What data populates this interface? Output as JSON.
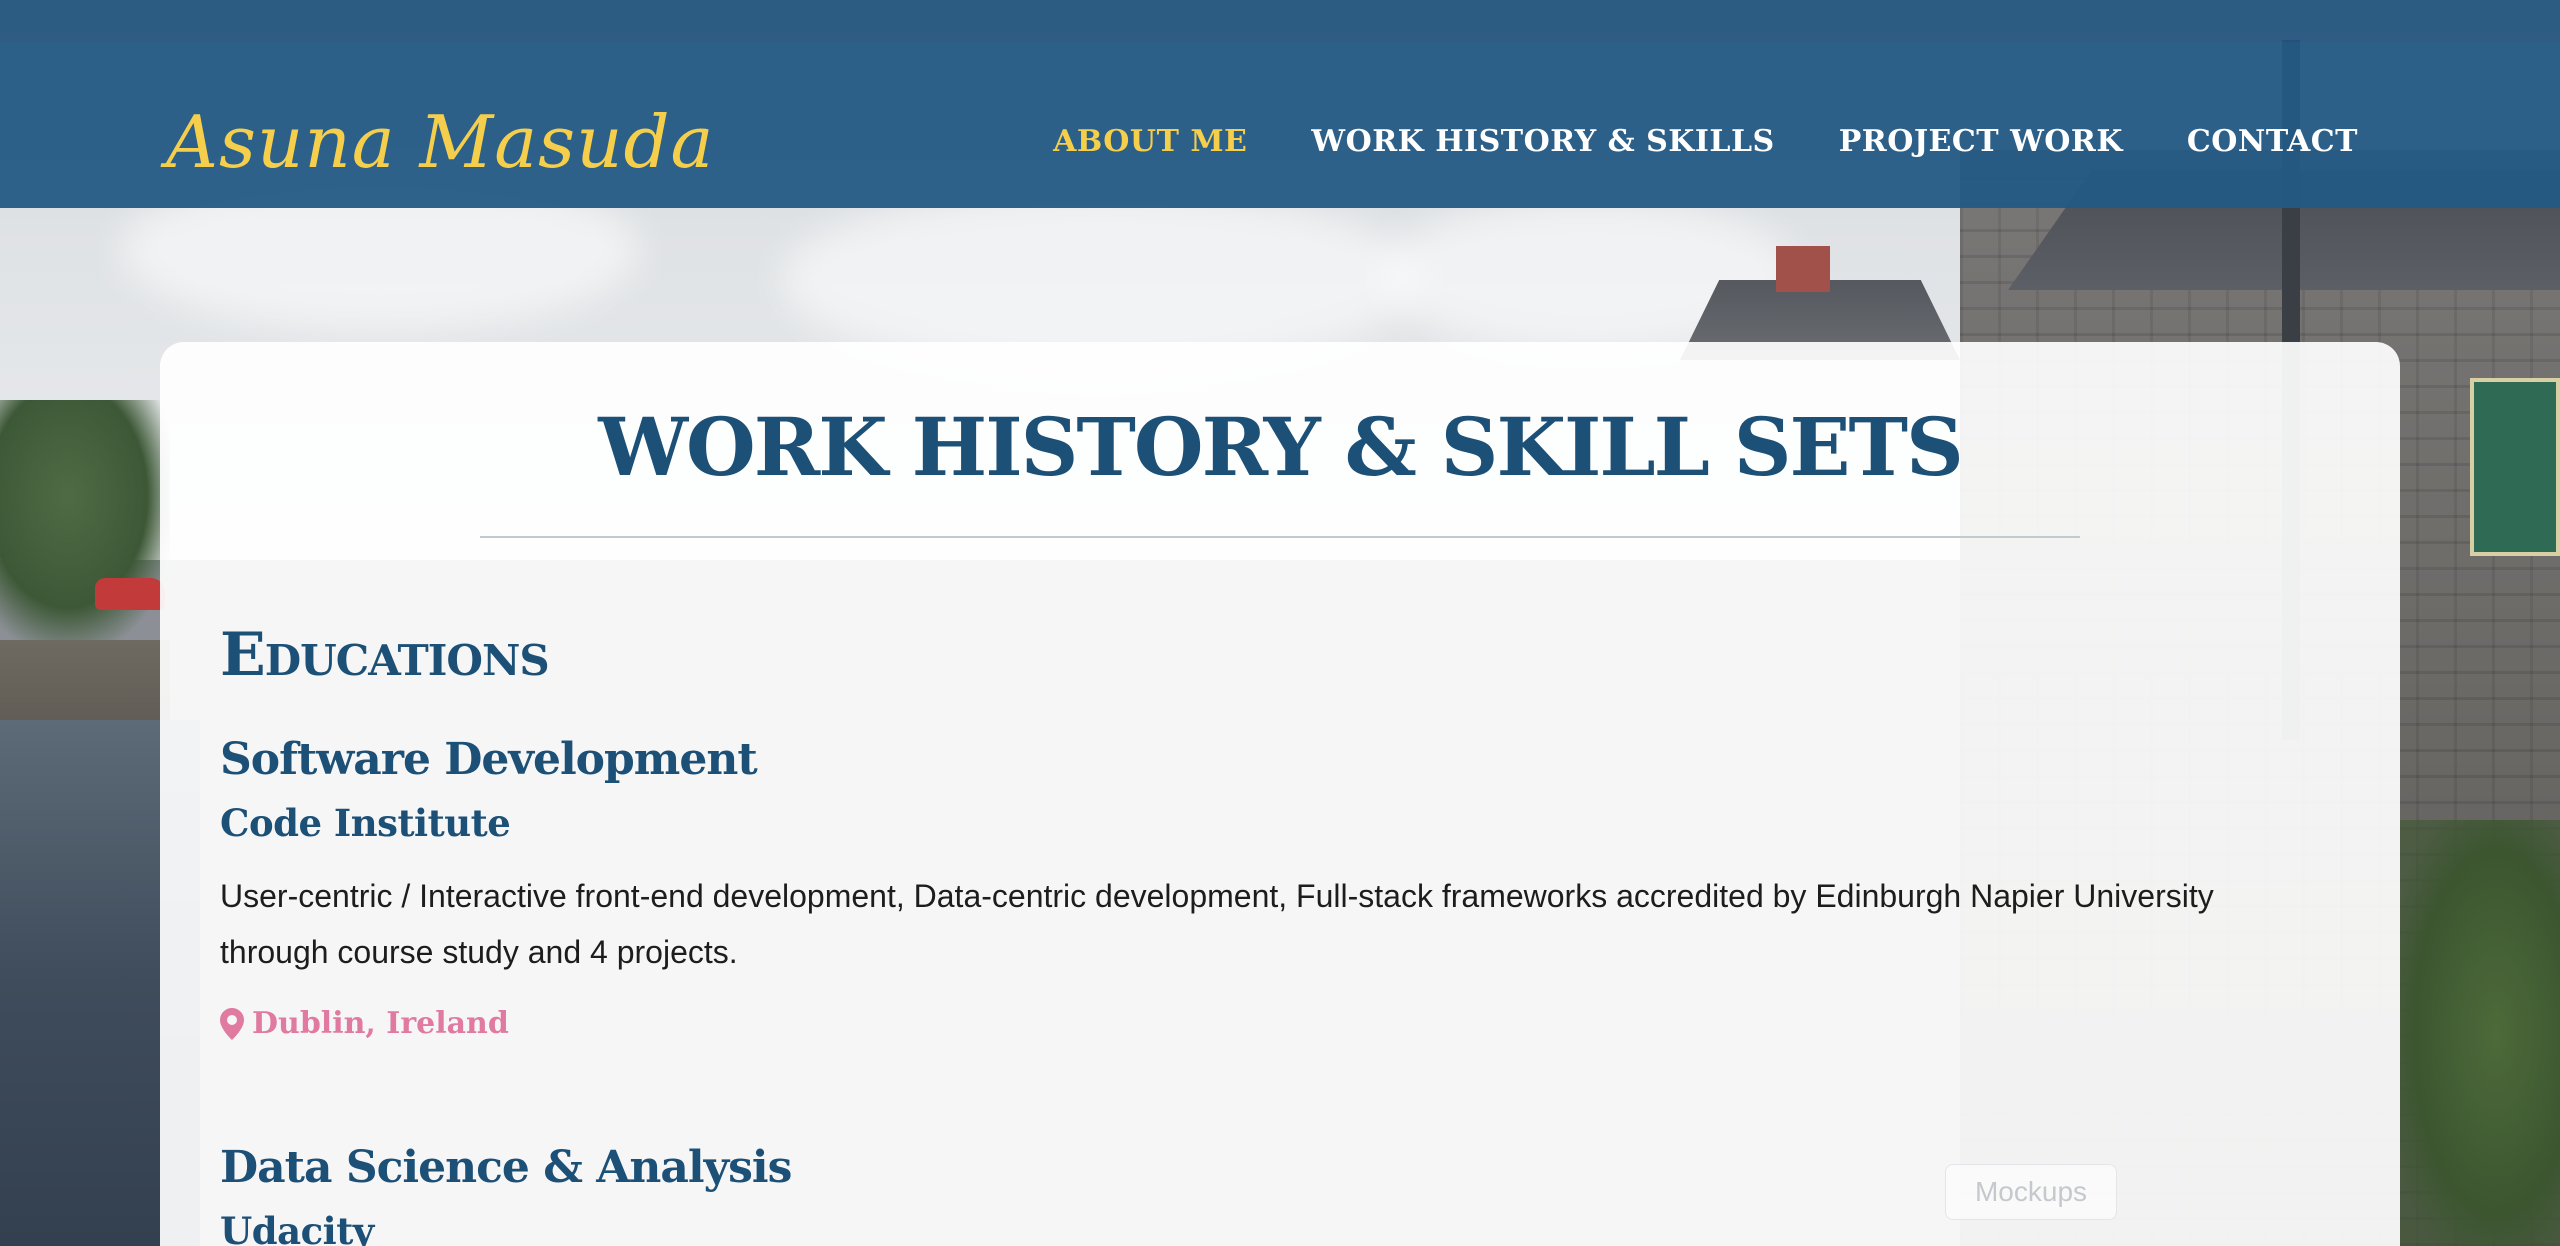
{
  "header": {
    "brand": "Asuna Masuda",
    "nav": [
      {
        "label": "About Me",
        "active": true
      },
      {
        "label": "Work History & Skills",
        "active": false
      },
      {
        "label": "Project Work",
        "active": false
      },
      {
        "label": "Contact",
        "active": false
      }
    ]
  },
  "main": {
    "page_title": "WORK HISTORY & SKILL SETS",
    "section_heading": "Educations",
    "entries": [
      {
        "title": "Software Development",
        "organization": "Code Institute",
        "description": "User-centric / Interactive front-end development, Data-centric development, Full-stack frameworks accredited by Edinburgh Napier University through course study and 4 projects.",
        "location": "Dublin, Ireland"
      },
      {
        "title": "Data Science & Analysis",
        "organization": "Udacity"
      }
    ],
    "mockups_label": "Mockups"
  },
  "colors": {
    "header_bg": "#245a84",
    "brand": "#f5cf4b",
    "nav_active": "#f5cf4b",
    "heading": "#1d5077",
    "location": "#e07aa0"
  },
  "icons": {
    "location": "map-pin-icon"
  }
}
